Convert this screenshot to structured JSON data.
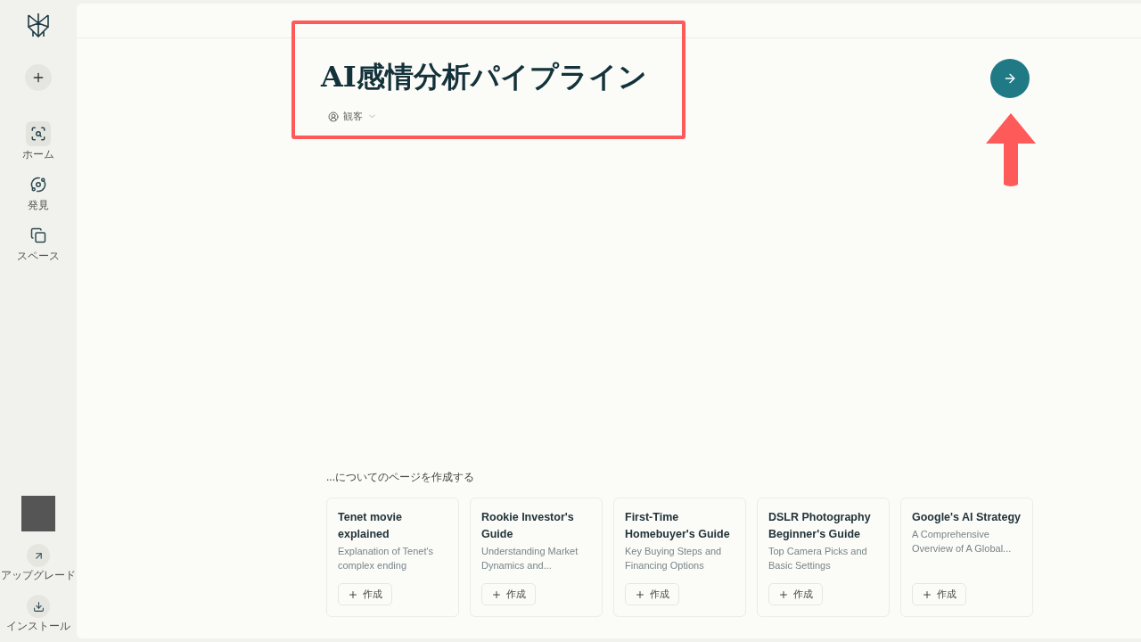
{
  "sidebar": {
    "nav": [
      {
        "kind": "home",
        "label": "ホーム",
        "selected": true
      },
      {
        "kind": "discover",
        "label": "発見",
        "selected": false
      },
      {
        "kind": "spaces",
        "label": "スペース",
        "selected": false
      }
    ],
    "bottom": [
      {
        "kind": "upgrade",
        "label": "アップグレード"
      },
      {
        "kind": "install",
        "label": "インストール"
      }
    ]
  },
  "page": {
    "title": "AI感情分析パイプライン",
    "audience": "観客"
  },
  "suggestions": {
    "heading": "...についてのページを作成する",
    "cards": [
      {
        "title": "Tenet movie explained",
        "description": "Explanation of Tenet's complex ending",
        "button": "作成"
      },
      {
        "title": "Rookie Investor's Guide",
        "description": "Understanding Market Dynamics and...",
        "button": "作成"
      },
      {
        "title": "First-Time Homebuyer's Guide",
        "description": "Key Buying Steps and Financing Options",
        "button": "作成"
      },
      {
        "title": "DSLR Photography Beginner's Guide",
        "description": "Top Camera Picks and Basic Settings",
        "button": "作成"
      },
      {
        "title": "Google's AI Strategy",
        "description": "A Comprehensive Overview of A Global...",
        "button": "作成"
      }
    ]
  }
}
